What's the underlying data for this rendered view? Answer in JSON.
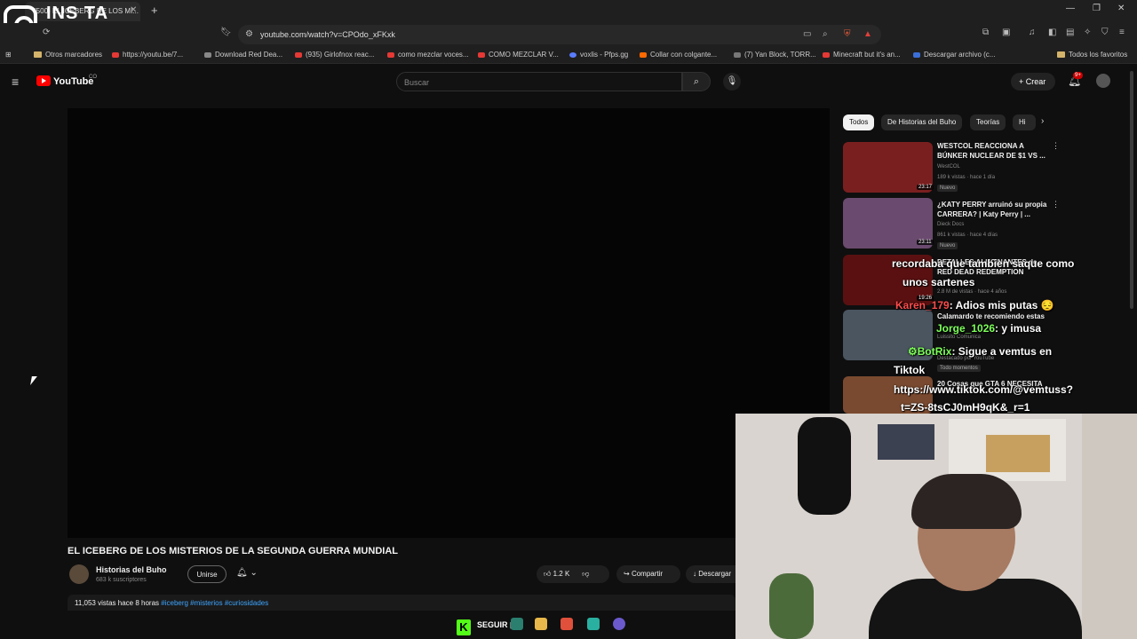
{
  "browser": {
    "tab_title": "(500) EL ICEBERG DE LOS MI...",
    "url": "youtube.com/watch?v=CPOdo_xFKxk",
    "bookmarks": [
      {
        "label": "Otros marcadores",
        "kind": "folder"
      },
      {
        "label": "https://youtu.be/7...",
        "kind": "yt"
      },
      {
        "label": "Download Red Dea...",
        "kind": "site"
      },
      {
        "label": "(935) Girlofnox reac...",
        "kind": "yt"
      },
      {
        "label": "como mezclar voces...",
        "kind": "yt"
      },
      {
        "label": "COMO MEZCLAR V...",
        "kind": "yt"
      },
      {
        "label": "voxlis - Pfps.gg",
        "kind": "site"
      },
      {
        "label": "Collar con colgante...",
        "kind": "site"
      },
      {
        "label": "(7) Yan Block, TORR...",
        "kind": "site"
      },
      {
        "label": "Minecraft but it's an...",
        "kind": "yt"
      },
      {
        "label": "Descargar archivo (c...",
        "kind": "site"
      },
      {
        "label": "Todos los favoritos",
        "kind": "folder"
      }
    ]
  },
  "overlay": {
    "insta_text": "INS TA"
  },
  "youtube": {
    "logo_text": "YouTube",
    "country": "CO",
    "search_placeholder": "Buscar",
    "crear_label": "Crear",
    "notif_count": "9+"
  },
  "video": {
    "title": "EL ICEBERG DE LOS MISTERIOS DE LA SEGUNDA GUERRA MUNDIAL",
    "channel": "Historias del Buho",
    "subscribers": "683 k suscriptores",
    "join_label": "Unirse",
    "likes": "1.2 K",
    "share_label": "Compartir",
    "download_label": "Descargar",
    "views_line": "11,053 vistas  hace 8 horas",
    "tags": "#iceberg #misterios #curiosidades"
  },
  "chips": [
    "Todos",
    "De Historias del Buho",
    "Teorías",
    "Hi"
  ],
  "recommendations": [
    {
      "title": "WESTCOL REACCIONA A BÚNKER NUCLEAR DE $1 VS ...",
      "channel": "WestCOL",
      "meta": "189 k vistas · hace 1 día",
      "badge": "Nuevo",
      "duration": "23:17",
      "color": "#7a1f1f"
    },
    {
      "title": "¿KATY PERRY arruinó su propia CARRERA? | Katy Perry | ...",
      "channel": "Dieck Docs",
      "meta": "861 k vistas · hace 4 días",
      "badge": "Nuevo",
      "duration": "23:11",
      "color": "#6a4a6e"
    },
    {
      "title": "DETALLES ALUCINANTES de RED DEAD REDEMPTION",
      "channel": "",
      "meta": "2.8 M de vistas · hace 4 años",
      "badge": "",
      "duration": "19:26",
      "color": "#5a1010"
    },
    {
      "title": "Calamardo te recomiendo estas",
      "channel": "Luissito Comunica",
      "meta": "Destacado por YouTube",
      "badge": "Todo momentos",
      "duration": "",
      "color": "#4a5560"
    },
    {
      "title": "20 Cosas que GTA 6 NECESITA",
      "channel": "",
      "meta": "",
      "badge": "",
      "duration": "",
      "color": "#7a4a30"
    }
  ],
  "chat": [
    {
      "user": "",
      "text": "recordaba que tambien saque como"
    },
    {
      "user": "",
      "text": "unos sartenes"
    },
    {
      "user": "Karen_179",
      "text": ": Adios mis putas 😔"
    },
    {
      "user": "Jorge_1026",
      "text": ": y imusa"
    },
    {
      "user": "BotRix",
      "text": ": Sigue a vemtus en"
    },
    {
      "user": "",
      "text": "Tiktok"
    },
    {
      "user": "",
      "text": "https://www.tiktok.com/@vemtuss?"
    },
    {
      "user": "",
      "text": "t=ZS-8tsCJ0mH9qK&_r=1"
    }
  ],
  "taskbar": {
    "seguir_label": "SEGUIR"
  }
}
